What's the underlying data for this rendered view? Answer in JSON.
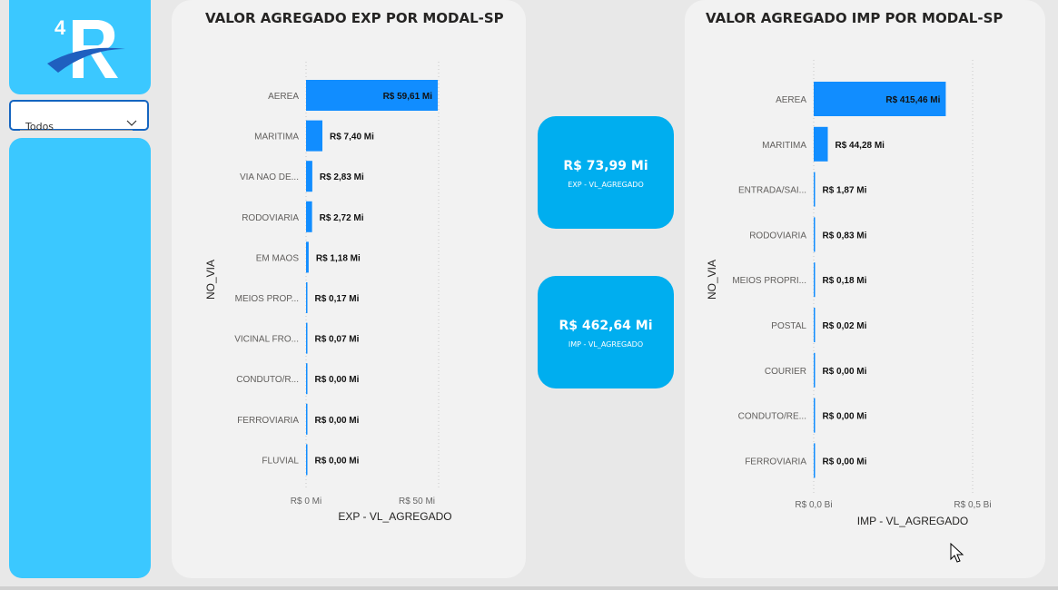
{
  "filter": {
    "selected": "Todos"
  },
  "exp_chart": {
    "title": "VALOR AGREGADO EXP POR MODAL-SP",
    "ylabel": "NO_VIA",
    "xlabel": "EXP - VL_AGREGADO",
    "ticks": [
      "R$ 0 Mi",
      "R$ 50 Mi"
    ]
  },
  "imp_chart": {
    "title": "VALOR AGREGADO IMP POR MODAL-SP",
    "ylabel": "NO_VIA",
    "xlabel": "IMP - VL_AGREGADO",
    "ticks": [
      "R$ 0,0 Bi",
      "R$ 0,5 Bi"
    ]
  },
  "kpi_exp": {
    "value": "R$ 73,99 Mi",
    "label": "EXP - VL_AGREGADO"
  },
  "kpi_imp": {
    "value": "R$ 462,64 Mi",
    "label": "IMP - VL_AGREGADO"
  },
  "colors": {
    "bar": "#118dff",
    "panel": "#3bc8ff",
    "kpi": "#00aeef",
    "card": "#f2f2f2"
  },
  "chart_data": [
    {
      "type": "bar",
      "orientation": "horizontal",
      "title": "VALOR AGREGADO EXP POR MODAL-SP",
      "xlabel": "EXP - VL_AGREGADO",
      "ylabel": "NO_VIA",
      "xlim": [
        0,
        60
      ],
      "categories": [
        "AEREA",
        "MARITIMA",
        "VIA NAO DE...",
        "RODOVIARIA",
        "EM MAOS",
        "MEIOS PROP...",
        "VICINAL FRO...",
        "CONDUTO/R...",
        "FERROVIARIA",
        "FLUVIAL"
      ],
      "values": [
        59.61,
        7.4,
        2.83,
        2.72,
        1.18,
        0.17,
        0.07,
        0.0,
        0.0,
        0.0
      ],
      "labels": [
        "R$ 59,61 Mi",
        "R$ 7,40 Mi",
        "R$ 2,83 Mi",
        "R$ 2,72 Mi",
        "R$ 1,18 Mi",
        "R$ 0,17 Mi",
        "R$ 0,07 Mi",
        "R$ 0,00 Mi",
        "R$ 0,00 Mi",
        "R$ 0,00 Mi"
      ]
    },
    {
      "type": "bar",
      "orientation": "horizontal",
      "title": "VALOR AGREGADO IMP POR MODAL-SP",
      "xlabel": "IMP - VL_AGREGADO",
      "ylabel": "NO_VIA",
      "xlim": [
        0,
        0.5
      ],
      "categories": [
        "AEREA",
        "MARITIMA",
        "ENTRADA/SAI...",
        "RODOVIARIA",
        "MEIOS PROPRI...",
        "POSTAL",
        "COURIER",
        "CONDUTO/RE...",
        "FERROVIARIA"
      ],
      "values": [
        0.41546,
        0.04428,
        0.00187,
        0.00083,
        0.00018,
        2e-05,
        0.0,
        0.0,
        0.0
      ],
      "labels": [
        "R$ 415,46 Mi",
        "R$ 44,28 Mi",
        "R$ 1,87 Mi",
        "R$ 0,83 Mi",
        "R$ 0,18 Mi",
        "R$ 0,02 Mi",
        "R$ 0,00 Mi",
        "R$ 0,00 Mi",
        "R$ 0,00 Mi"
      ]
    }
  ]
}
